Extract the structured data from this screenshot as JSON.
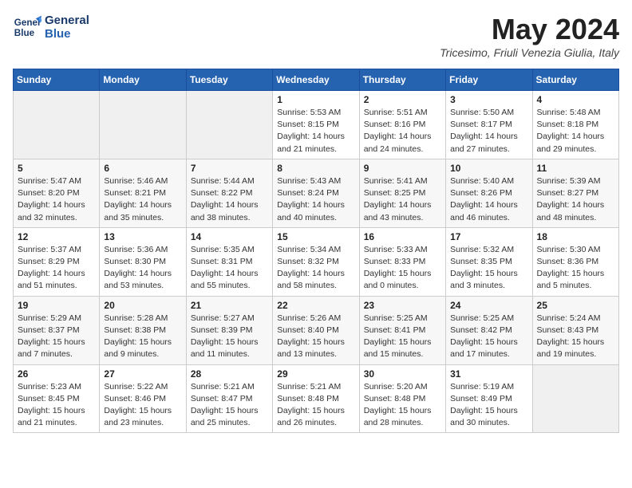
{
  "logo": {
    "line1": "General",
    "line2": "Blue"
  },
  "title": "May 2024",
  "location": "Tricesimo, Friuli Venezia Giulia, Italy",
  "days_of_week": [
    "Sunday",
    "Monday",
    "Tuesday",
    "Wednesday",
    "Thursday",
    "Friday",
    "Saturday"
  ],
  "weeks": [
    [
      {
        "day": "",
        "info": ""
      },
      {
        "day": "",
        "info": ""
      },
      {
        "day": "",
        "info": ""
      },
      {
        "day": "1",
        "info": "Sunrise: 5:53 AM\nSunset: 8:15 PM\nDaylight: 14 hours\nand 21 minutes."
      },
      {
        "day": "2",
        "info": "Sunrise: 5:51 AM\nSunset: 8:16 PM\nDaylight: 14 hours\nand 24 minutes."
      },
      {
        "day": "3",
        "info": "Sunrise: 5:50 AM\nSunset: 8:17 PM\nDaylight: 14 hours\nand 27 minutes."
      },
      {
        "day": "4",
        "info": "Sunrise: 5:48 AM\nSunset: 8:18 PM\nDaylight: 14 hours\nand 29 minutes."
      }
    ],
    [
      {
        "day": "5",
        "info": "Sunrise: 5:47 AM\nSunset: 8:20 PM\nDaylight: 14 hours\nand 32 minutes."
      },
      {
        "day": "6",
        "info": "Sunrise: 5:46 AM\nSunset: 8:21 PM\nDaylight: 14 hours\nand 35 minutes."
      },
      {
        "day": "7",
        "info": "Sunrise: 5:44 AM\nSunset: 8:22 PM\nDaylight: 14 hours\nand 38 minutes."
      },
      {
        "day": "8",
        "info": "Sunrise: 5:43 AM\nSunset: 8:24 PM\nDaylight: 14 hours\nand 40 minutes."
      },
      {
        "day": "9",
        "info": "Sunrise: 5:41 AM\nSunset: 8:25 PM\nDaylight: 14 hours\nand 43 minutes."
      },
      {
        "day": "10",
        "info": "Sunrise: 5:40 AM\nSunset: 8:26 PM\nDaylight: 14 hours\nand 46 minutes."
      },
      {
        "day": "11",
        "info": "Sunrise: 5:39 AM\nSunset: 8:27 PM\nDaylight: 14 hours\nand 48 minutes."
      }
    ],
    [
      {
        "day": "12",
        "info": "Sunrise: 5:37 AM\nSunset: 8:29 PM\nDaylight: 14 hours\nand 51 minutes."
      },
      {
        "day": "13",
        "info": "Sunrise: 5:36 AM\nSunset: 8:30 PM\nDaylight: 14 hours\nand 53 minutes."
      },
      {
        "day": "14",
        "info": "Sunrise: 5:35 AM\nSunset: 8:31 PM\nDaylight: 14 hours\nand 55 minutes."
      },
      {
        "day": "15",
        "info": "Sunrise: 5:34 AM\nSunset: 8:32 PM\nDaylight: 14 hours\nand 58 minutes."
      },
      {
        "day": "16",
        "info": "Sunrise: 5:33 AM\nSunset: 8:33 PM\nDaylight: 15 hours\nand 0 minutes."
      },
      {
        "day": "17",
        "info": "Sunrise: 5:32 AM\nSunset: 8:35 PM\nDaylight: 15 hours\nand 3 minutes."
      },
      {
        "day": "18",
        "info": "Sunrise: 5:30 AM\nSunset: 8:36 PM\nDaylight: 15 hours\nand 5 minutes."
      }
    ],
    [
      {
        "day": "19",
        "info": "Sunrise: 5:29 AM\nSunset: 8:37 PM\nDaylight: 15 hours\nand 7 minutes."
      },
      {
        "day": "20",
        "info": "Sunrise: 5:28 AM\nSunset: 8:38 PM\nDaylight: 15 hours\nand 9 minutes."
      },
      {
        "day": "21",
        "info": "Sunrise: 5:27 AM\nSunset: 8:39 PM\nDaylight: 15 hours\nand 11 minutes."
      },
      {
        "day": "22",
        "info": "Sunrise: 5:26 AM\nSunset: 8:40 PM\nDaylight: 15 hours\nand 13 minutes."
      },
      {
        "day": "23",
        "info": "Sunrise: 5:25 AM\nSunset: 8:41 PM\nDaylight: 15 hours\nand 15 minutes."
      },
      {
        "day": "24",
        "info": "Sunrise: 5:25 AM\nSunset: 8:42 PM\nDaylight: 15 hours\nand 17 minutes."
      },
      {
        "day": "25",
        "info": "Sunrise: 5:24 AM\nSunset: 8:43 PM\nDaylight: 15 hours\nand 19 minutes."
      }
    ],
    [
      {
        "day": "26",
        "info": "Sunrise: 5:23 AM\nSunset: 8:45 PM\nDaylight: 15 hours\nand 21 minutes."
      },
      {
        "day": "27",
        "info": "Sunrise: 5:22 AM\nSunset: 8:46 PM\nDaylight: 15 hours\nand 23 minutes."
      },
      {
        "day": "28",
        "info": "Sunrise: 5:21 AM\nSunset: 8:47 PM\nDaylight: 15 hours\nand 25 minutes."
      },
      {
        "day": "29",
        "info": "Sunrise: 5:21 AM\nSunset: 8:48 PM\nDaylight: 15 hours\nand 26 minutes."
      },
      {
        "day": "30",
        "info": "Sunrise: 5:20 AM\nSunset: 8:48 PM\nDaylight: 15 hours\nand 28 minutes."
      },
      {
        "day": "31",
        "info": "Sunrise: 5:19 AM\nSunset: 8:49 PM\nDaylight: 15 hours\nand 30 minutes."
      },
      {
        "day": "",
        "info": ""
      }
    ]
  ]
}
